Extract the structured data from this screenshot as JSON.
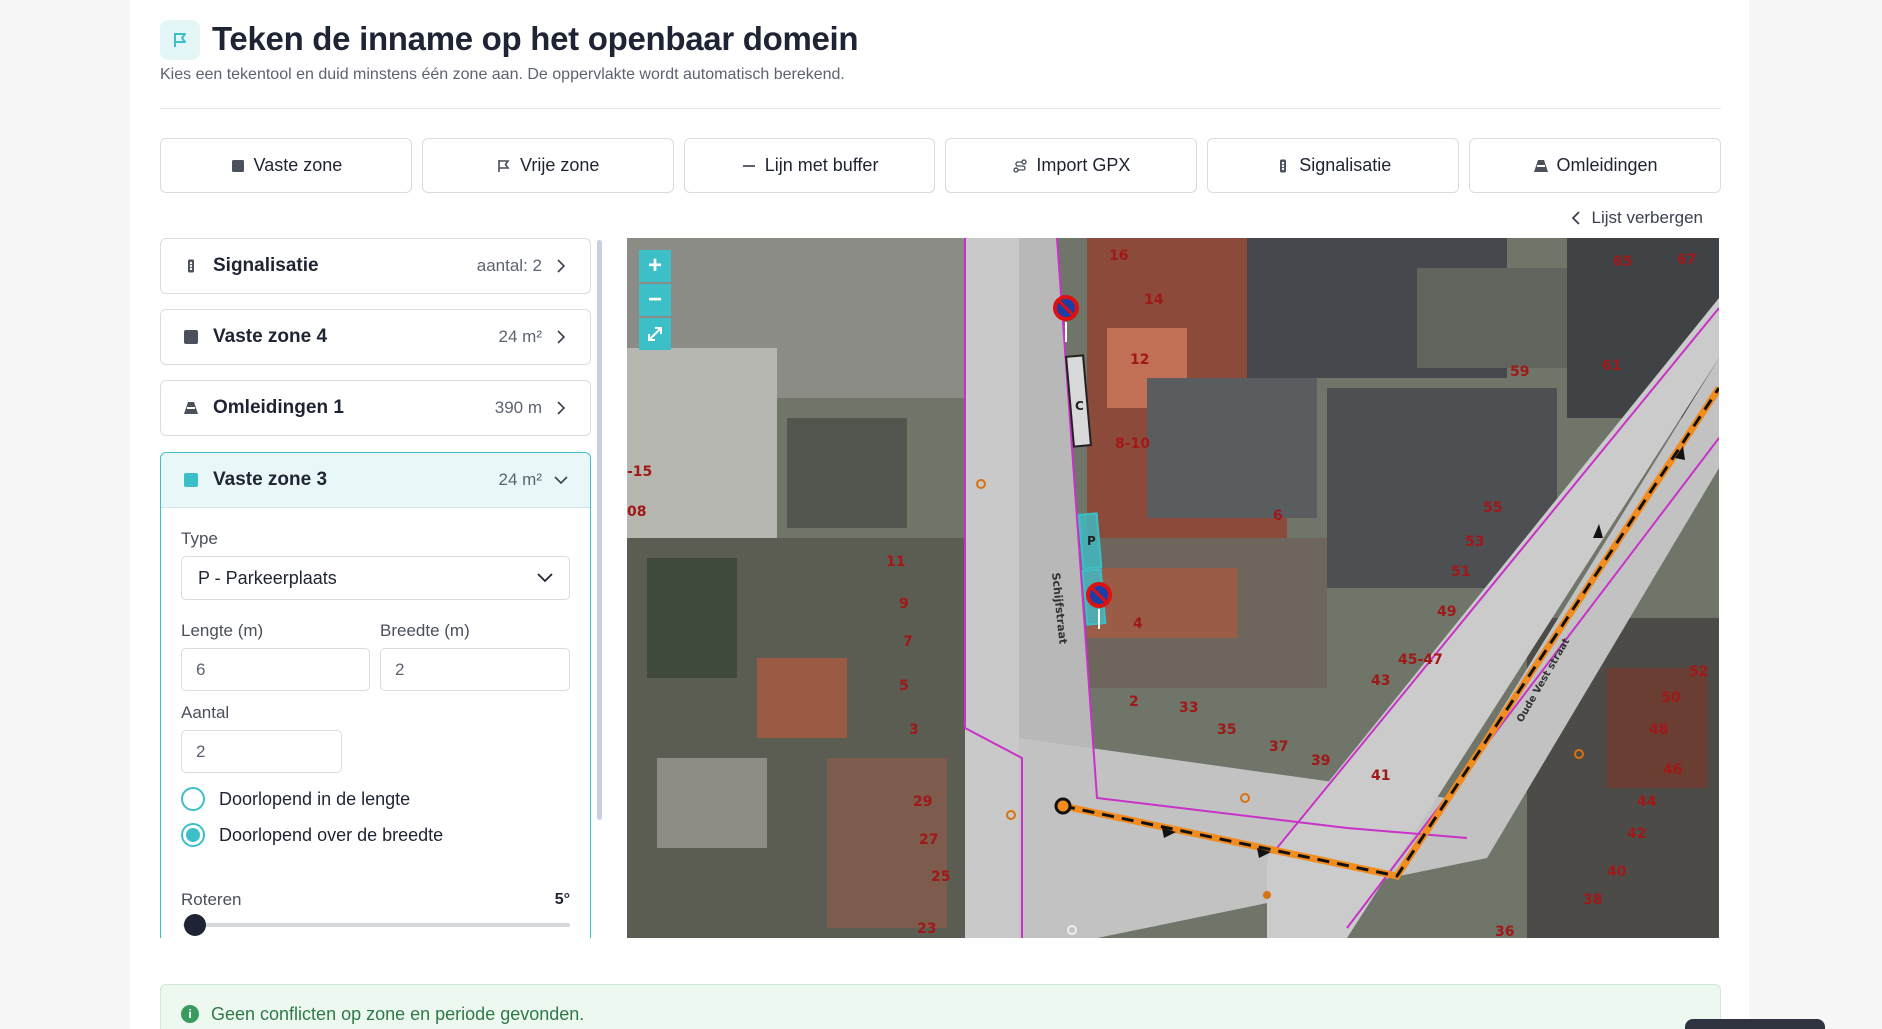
{
  "header": {
    "title": "Teken de inname op het openbaar domein",
    "subtitle": "Kies een tekentool en duid minstens één zone aan. De oppervlakte wordt automatisch berekend."
  },
  "toolbar": [
    {
      "label": "Vaste zone",
      "icon": "square-icon"
    },
    {
      "label": "Vrije zone",
      "icon": "flag-icon"
    },
    {
      "label": "Lijn met buffer",
      "icon": "line-icon"
    },
    {
      "label": "Import GPX",
      "icon": "route-icon"
    },
    {
      "label": "Signalisatie",
      "icon": "sign-icon"
    },
    {
      "label": "Omleidingen",
      "icon": "barrier-icon"
    }
  ],
  "list_toggle": "Lijst verbergen",
  "list": [
    {
      "name": "Signalisatie",
      "meta": "aantal: 2"
    },
    {
      "name": "Vaste zone 4",
      "meta": "24 m²"
    },
    {
      "name": "Omleidingen 1",
      "meta": "390 m"
    }
  ],
  "expanded": {
    "name": "Vaste zone 3",
    "meta": "24 m²",
    "type_label": "Type",
    "type_value": "P - Parkeerplaats",
    "length_label": "Lengte (m)",
    "length_value": "6",
    "width_label": "Breedte (m)",
    "width_value": "2",
    "count_label": "Aantal",
    "count_value": "2",
    "radio_length": "Doorlopend in de lengte",
    "radio_width": "Doorlopend over de breedte",
    "radio_selected": "width",
    "rotate_label": "Roteren",
    "rotate_value": "5°",
    "rotate_fraction": 0.014
  },
  "map": {
    "zoom_in": "+",
    "zoom_out": "−",
    "street_label": "Schijfstraat",
    "street_label_2": "Oude Vest straat",
    "house_numbers": [
      "16",
      "14",
      "12",
      "8-10",
      "6",
      "4",
      "2",
      "33",
      "35",
      "37",
      "39",
      "41",
      "43",
      "45-47",
      "49",
      "51",
      "53",
      "55",
      "59",
      "61",
      "65",
      "67",
      "11",
      "9",
      "7",
      "5",
      "3",
      "29",
      "27",
      "25",
      "23",
      "-15",
      "08",
      "52",
      "50",
      "48",
      "46",
      "44",
      "42",
      "40",
      "38",
      "36"
    ],
    "marker_labels": [
      "C",
      "P",
      "P"
    ],
    "accent": "#3dbfc8",
    "route_color": "#f28c1f",
    "boundary_color": "#c832c8"
  },
  "alert": {
    "text": "Geen conflicten op zone en periode gevonden."
  }
}
